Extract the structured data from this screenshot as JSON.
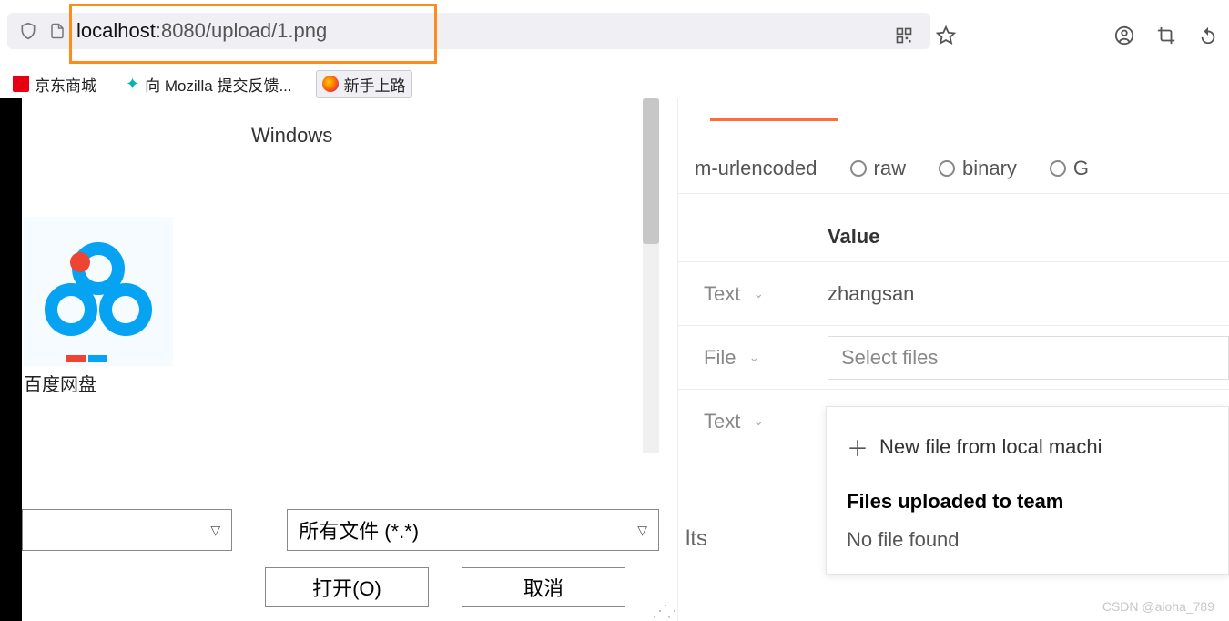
{
  "browser": {
    "url_host": "localhost",
    "url_rest": ":8080/upload/1.png"
  },
  "bookmarks": {
    "jd": "京东商城",
    "mozilla": "向 Mozilla 提交反馈...",
    "newbie": "新手上路"
  },
  "file_dialog": {
    "label_clash": "Windows",
    "icon_baidu": "百度网盘",
    "filter": "所有文件 (*.*)",
    "open": "打开(O)",
    "cancel": "取消"
  },
  "postman": {
    "body_opts": {
      "urlencoded": "m-urlencoded",
      "raw": "raw",
      "binary": "binary",
      "graphql": "G"
    },
    "header_value": "Value",
    "rows": [
      {
        "type": "Text",
        "value": "zhangsan"
      },
      {
        "type": "File",
        "value": "Select files"
      },
      {
        "type": "Text",
        "value": ""
      }
    ],
    "dropdown": {
      "new_file": "New file from local machi",
      "section": "Files uploaded to team",
      "none": "No file found"
    },
    "results": "lts"
  },
  "watermark": "CSDN @aloha_789"
}
